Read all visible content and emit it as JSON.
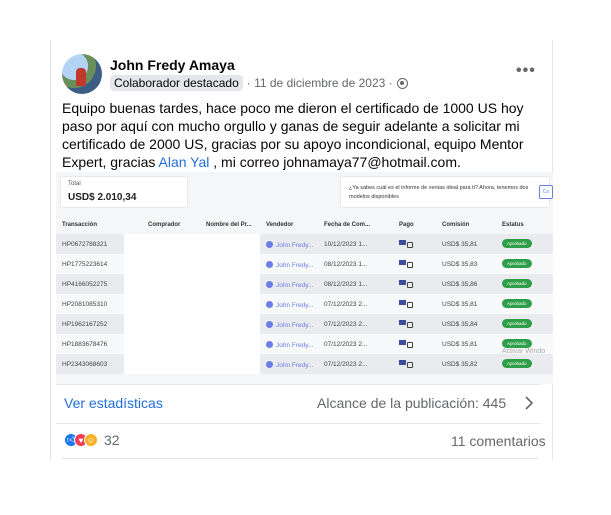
{
  "post": {
    "author": "John Fredy Amaya",
    "badge": "Colaborador destacado",
    "date": "· 11 de diciembre de 2023 ·",
    "more": "•••",
    "text_before": "Equipo buenas tardes, hace poco me dieron el certificado de 1000 US hoy paso por aquí con mucho orgullo y ganas de seguir adelante a solicitar mi certificado de 2000 US, gracias por su apoyo incondicional, equipo Mentor Expert, gracias ",
    "mention": "Alan Yal",
    "text_after": " , mi correo johnamaya77@hotmail.com."
  },
  "screenshot": {
    "total_label": "Total",
    "total_value": "USD$ 2.010,34",
    "info_text": "¿Ya sabes cuál es el informe de ventas ideal para ti? Ahora, tenemos dos modelos disponibles",
    "info_button": "Co",
    "columns": [
      "Transacción",
      "Comprador",
      "Nombre del Pr...",
      "Vendedor",
      "Fecha de Com...",
      "Pago",
      "Comisión",
      "Estatus"
    ],
    "rows": [
      {
        "id": "HP0672788321",
        "vendor": "John Fredy...",
        "date": "10/12/2023 1...",
        "commission": "USD$ 35,81",
        "status": "Aprobado"
      },
      {
        "id": "HP1775223614",
        "vendor": "John Fredy...",
        "date": "08/12/2023 1...",
        "commission": "USD$ 35,83",
        "status": "Aprobado"
      },
      {
        "id": "HP4166052275",
        "vendor": "John Fredy...",
        "date": "08/12/2023 1...",
        "commission": "USD$ 35,86",
        "status": "Aprobado"
      },
      {
        "id": "HP2081085310",
        "vendor": "John Fredy...",
        "date": "07/12/2023 2...",
        "commission": "USD$ 35,81",
        "status": "Aprobado"
      },
      {
        "id": "HP1962167252",
        "vendor": "John Fredy...",
        "date": "07/12/2023 2...",
        "commission": "USD$ 35,84",
        "status": "Aprobado"
      },
      {
        "id": "HP1883678476",
        "vendor": "John Fredy...",
        "date": "07/12/2023 2...",
        "commission": "USD$ 35,81",
        "status": "Aprobado"
      },
      {
        "id": "HP2343068603",
        "vendor": "John Fredy...",
        "date": "07/12/2023 2...",
        "commission": "USD$ 35,82",
        "status": "Aprobado"
      }
    ],
    "watermark": "Activar Windo"
  },
  "footer": {
    "stats_link": "Ver estadísticas",
    "reach": "Alcance de la publicación: 445",
    "reaction_count": "32",
    "comments": "11 comentarios"
  },
  "icons": [
    "avatar",
    "globe-icon",
    "more-icon",
    "chevron-right-icon",
    "like-icon",
    "love-icon",
    "care-icon",
    "vendor-icon",
    "payment-icon"
  ],
  "colors": {
    "link": "#216fdb",
    "status_green": "#2e9e48",
    "like": "#1877f2",
    "love": "#f33e58",
    "care": "#f7b125"
  }
}
